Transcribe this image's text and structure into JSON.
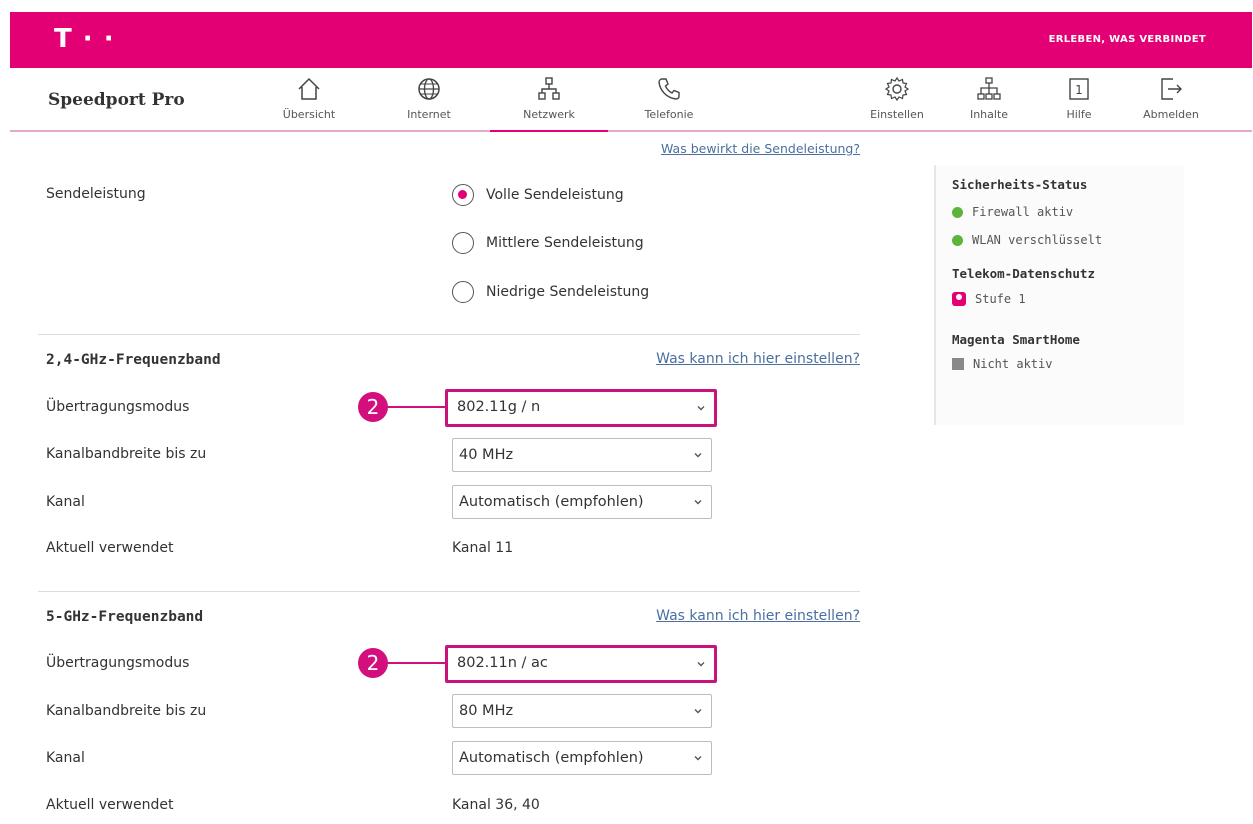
{
  "header": {
    "logo": "T · ·",
    "slogan": "ERLEBEN, WAS VERBINDET"
  },
  "nav": {
    "brand": "Speedport Pro",
    "items": [
      {
        "label": "Übersicht",
        "icon": "home-icon"
      },
      {
        "label": "Internet",
        "icon": "globe-icon"
      },
      {
        "label": "Netzwerk",
        "icon": "network-icon",
        "active": true
      },
      {
        "label": "Telefonie",
        "icon": "phone-icon"
      },
      {
        "label": "Einstellen",
        "icon": "gear-icon"
      },
      {
        "label": "Inhalte",
        "icon": "content-icon"
      },
      {
        "label": "Hilfe",
        "icon": "help-icon"
      },
      {
        "label": "Abmelden",
        "icon": "logout-icon"
      }
    ]
  },
  "power": {
    "help_link": "Was bewirkt die Sendeleistung?",
    "label": "Sendeleistung",
    "options": [
      "Volle Sendeleistung",
      "Mittlere Sendeleistung",
      "Niedrige Sendeleistung"
    ],
    "selected": "Volle Sendeleistung"
  },
  "band24": {
    "title": "2,4-GHz-Frequenzband",
    "help_link": "Was kann ich hier einstellen?",
    "mode_label": "Übertragungsmodus",
    "mode_value": "802.11g / n",
    "bandwidth_label": "Kanalbandbreite bis zu",
    "bandwidth_value": "40 MHz",
    "channel_label": "Kanal",
    "channel_value": "Automatisch (empfohlen)",
    "current_label": "Aktuell verwendet",
    "current_value": "Kanal 11",
    "marker": "2"
  },
  "band5": {
    "title": "5-GHz-Frequenzband",
    "help_link": "Was kann ich hier einstellen?",
    "mode_label": "Übertragungsmodus",
    "mode_value": "802.11n / ac",
    "bandwidth_label": "Kanalbandbreite bis zu",
    "bandwidth_value": "80 MHz",
    "channel_label": "Kanal",
    "channel_value": "Automatisch (empfohlen)",
    "current_label": "Aktuell verwendet",
    "current_value": "Kanal 36, 40",
    "marker": "2"
  },
  "sidebar": {
    "security_title": "Sicherheits-Status",
    "firewall": "Firewall aktiv",
    "wlan": "WLAN verschlüsselt",
    "privacy_title": "Telekom-Datenschutz",
    "privacy_value": "Stufe 1",
    "smarthome_title": "Magenta SmartHome",
    "smarthome_value": "Nicht aktiv"
  },
  "colors": {
    "brand": "#e20074",
    "highlight": "#c8137a",
    "link": "#4a6fa0",
    "status_ok": "#5cb43a"
  }
}
